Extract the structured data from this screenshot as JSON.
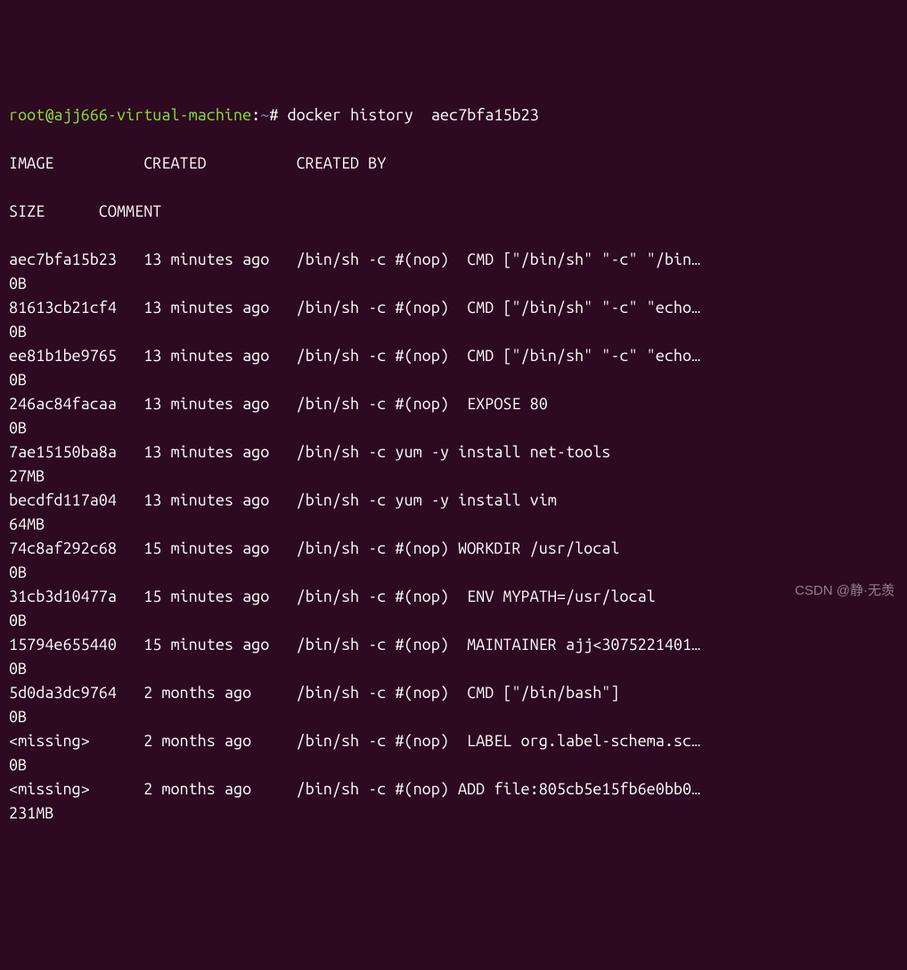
{
  "prompt": {
    "user_host": "root@ajj666-virtual-machine",
    "path": "~",
    "separator": "#",
    "command": "docker history  aec7bfa15b23"
  },
  "header": {
    "line1": "IMAGE          CREATED          CREATED BY",
    "line2": "SIZE      COMMENT"
  },
  "rows": [
    {
      "l1": "aec7bfa15b23   13 minutes ago   /bin/sh -c #(nop)  CMD [\"/bin/sh\" \"-c\" \"/bin…",
      "l2": "0B"
    },
    {
      "l1": "81613cb21cf4   13 minutes ago   /bin/sh -c #(nop)  CMD [\"/bin/sh\" \"-c\" \"echo…",
      "l2": "0B"
    },
    {
      "l1": "ee81b1be9765   13 minutes ago   /bin/sh -c #(nop)  CMD [\"/bin/sh\" \"-c\" \"echo…",
      "l2": "0B"
    },
    {
      "l1": "246ac84facaa   13 minutes ago   /bin/sh -c #(nop)  EXPOSE 80",
      "l2": "0B"
    },
    {
      "l1": "7ae15150ba8a   13 minutes ago   /bin/sh -c yum -y install net-tools",
      "l2": "27MB"
    },
    {
      "l1": "becdfd117a04   13 minutes ago   /bin/sh -c yum -y install vim",
      "l2": "64MB"
    },
    {
      "l1": "74c8af292c68   15 minutes ago   /bin/sh -c #(nop) WORKDIR /usr/local",
      "l2": "0B"
    },
    {
      "l1": "31cb3d10477a   15 minutes ago   /bin/sh -c #(nop)  ENV MYPATH=/usr/local",
      "l2": "0B"
    },
    {
      "l1": "15794e655440   15 minutes ago   /bin/sh -c #(nop)  MAINTAINER ajj<3075221401…",
      "l2": "0B"
    },
    {
      "l1": "5d0da3dc9764   2 months ago     /bin/sh -c #(nop)  CMD [\"/bin/bash\"]",
      "l2": "0B"
    },
    {
      "l1": "<missing>      2 months ago     /bin/sh -c #(nop)  LABEL org.label-schema.sc…",
      "l2": "0B"
    },
    {
      "l1": "<missing>      2 months ago     /bin/sh -c #(nop) ADD file:805cb5e15fb6e0bb0…",
      "l2": "231MB"
    }
  ],
  "watermark": "CSDN @静·无羡"
}
